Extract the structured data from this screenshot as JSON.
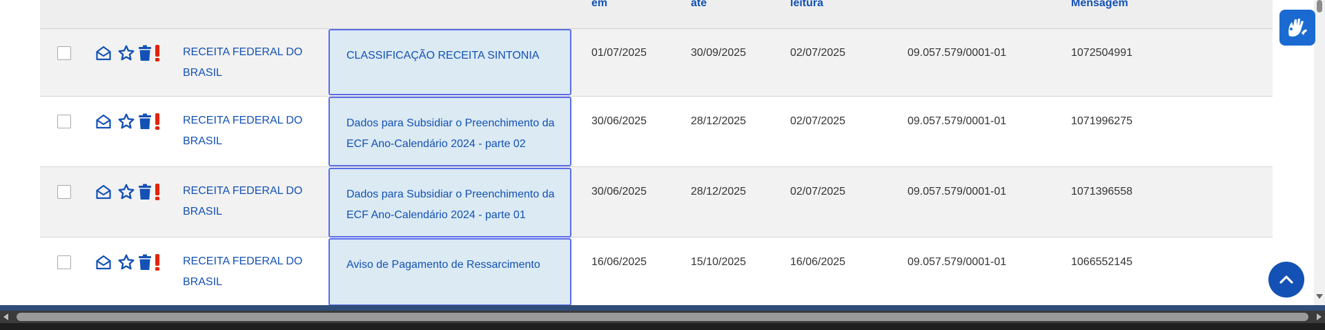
{
  "table": {
    "headers": {
      "col_sent": "em",
      "col_until": "até",
      "col_read": "leitura",
      "col_message": "Mensagem"
    },
    "rows": [
      {
        "sender": "RECEITA FEDERAL DO BRASIL",
        "subject": "CLASSIFICAÇÃO RECEITA SINTONIA",
        "sent": "01/07/2025",
        "until": "30/09/2025",
        "read": "02/07/2025",
        "cnpj": "09.057.579/0001-01",
        "message_id": "1072504991"
      },
      {
        "sender": "RECEITA FEDERAL DO BRASIL",
        "subject": "Dados para Subsidiar o Preenchimento da ECF Ano-Calendário 2024 - parte 02",
        "sent": "30/06/2025",
        "until": "28/12/2025",
        "read": "02/07/2025",
        "cnpj": "09.057.579/0001-01",
        "message_id": "1071996275"
      },
      {
        "sender": "RECEITA FEDERAL DO BRASIL",
        "subject": "Dados para Subsidiar o Preenchimento da ECF Ano-Calendário 2024 - parte 01",
        "sent": "30/06/2025",
        "until": "28/12/2025",
        "read": "02/07/2025",
        "cnpj": "09.057.579/0001-01",
        "message_id": "1071396558"
      },
      {
        "sender": "RECEITA FEDERAL DO BRASIL",
        "subject": "Aviso de Pagamento de Ressarcimento",
        "sent": "16/06/2025",
        "until": "15/10/2025",
        "read": "16/06/2025",
        "cnpj": "09.057.579/0001-01",
        "message_id": "1066552145"
      }
    ]
  },
  "icons": {
    "mark_read": "envelope-open-icon",
    "favorite": "star-icon",
    "delete": "trash-icon",
    "important": "exclamation-icon",
    "accessibility": "sign-language-hands-icon",
    "scroll_top": "chevron-up-icon"
  },
  "colors": {
    "link_blue": "#1351b4",
    "important_red": "#e52207",
    "subject_bg": "#dbeaf3",
    "subject_border": "#5a6ce6",
    "header_bg": "#eeeeee",
    "odd_row_bg": "#f2f2f2",
    "a11y_button": "#1a6ad1"
  }
}
